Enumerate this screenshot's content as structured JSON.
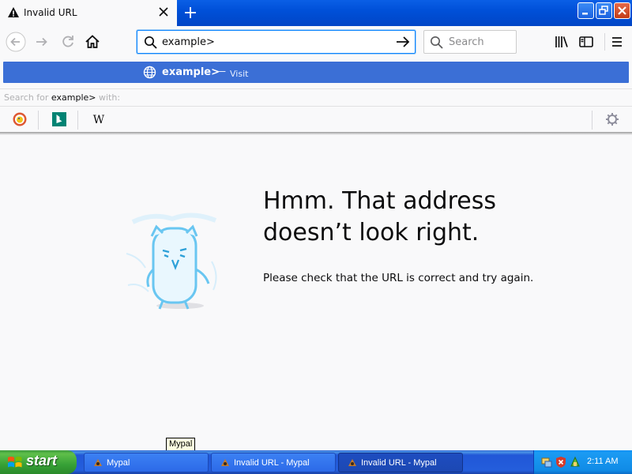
{
  "window": {
    "tab_title": "Invalid URL"
  },
  "navbar": {
    "url_value": "example>",
    "search_placeholder": "Search"
  },
  "dropdown": {
    "visit_text": "example>",
    "visit_separator": "—",
    "visit_label": "Visit",
    "search_for_prefix": "Search for ",
    "search_for_query": "example>",
    "search_for_suffix": " with:",
    "engines": [
      "duckduckgo-icon",
      "bing-icon",
      "wikipedia-icon"
    ]
  },
  "content": {
    "heading_line1": "Hmm. That address",
    "heading_line2": "doesn’t look right.",
    "description": "Please check that the URL is correct and try again."
  },
  "tooltip": {
    "text": "Mypal"
  },
  "taskbar": {
    "start_label": "start",
    "tasks": [
      {
        "label": "Mypal",
        "active": false
      },
      {
        "label": "Invalid URL - Mypal",
        "active": false
      },
      {
        "label": "Invalid URL - Mypal",
        "active": true
      }
    ],
    "clock": "2:11 AM"
  },
  "colors": {
    "accent": "#0a84ff",
    "visit_row": "#3b6fd6",
    "taskbar": "#245edc",
    "start": "#37a137"
  }
}
